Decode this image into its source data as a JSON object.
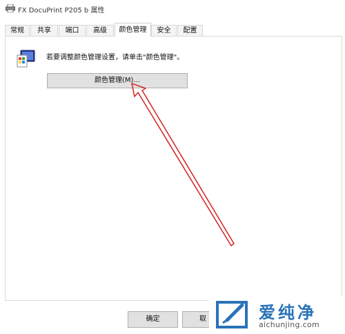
{
  "window": {
    "title": "FX DocuPrint P205 b 属性",
    "icon": "printer-icon"
  },
  "tabs": [
    {
      "label": "常规",
      "active": false
    },
    {
      "label": "共享",
      "active": false
    },
    {
      "label": "端口",
      "active": false
    },
    {
      "label": "高级",
      "active": false
    },
    {
      "label": "颜色管理",
      "active": true
    },
    {
      "label": "安全",
      "active": false
    },
    {
      "label": "配置",
      "active": false
    }
  ],
  "color_panel": {
    "icon": "color-management-icon",
    "instruction": "若要调整颜色管理设置，请单击\"颜色管理\"。",
    "button_label": "颜色管理(M)..."
  },
  "footer": {
    "ok_label": "确定",
    "cancel_label": "取"
  },
  "annotation": {
    "type": "red-arrow",
    "color": "#d42b2b"
  },
  "watermark": {
    "brand": "爱纯净",
    "url": "aichunjing.com",
    "color": "#2a73b8"
  }
}
